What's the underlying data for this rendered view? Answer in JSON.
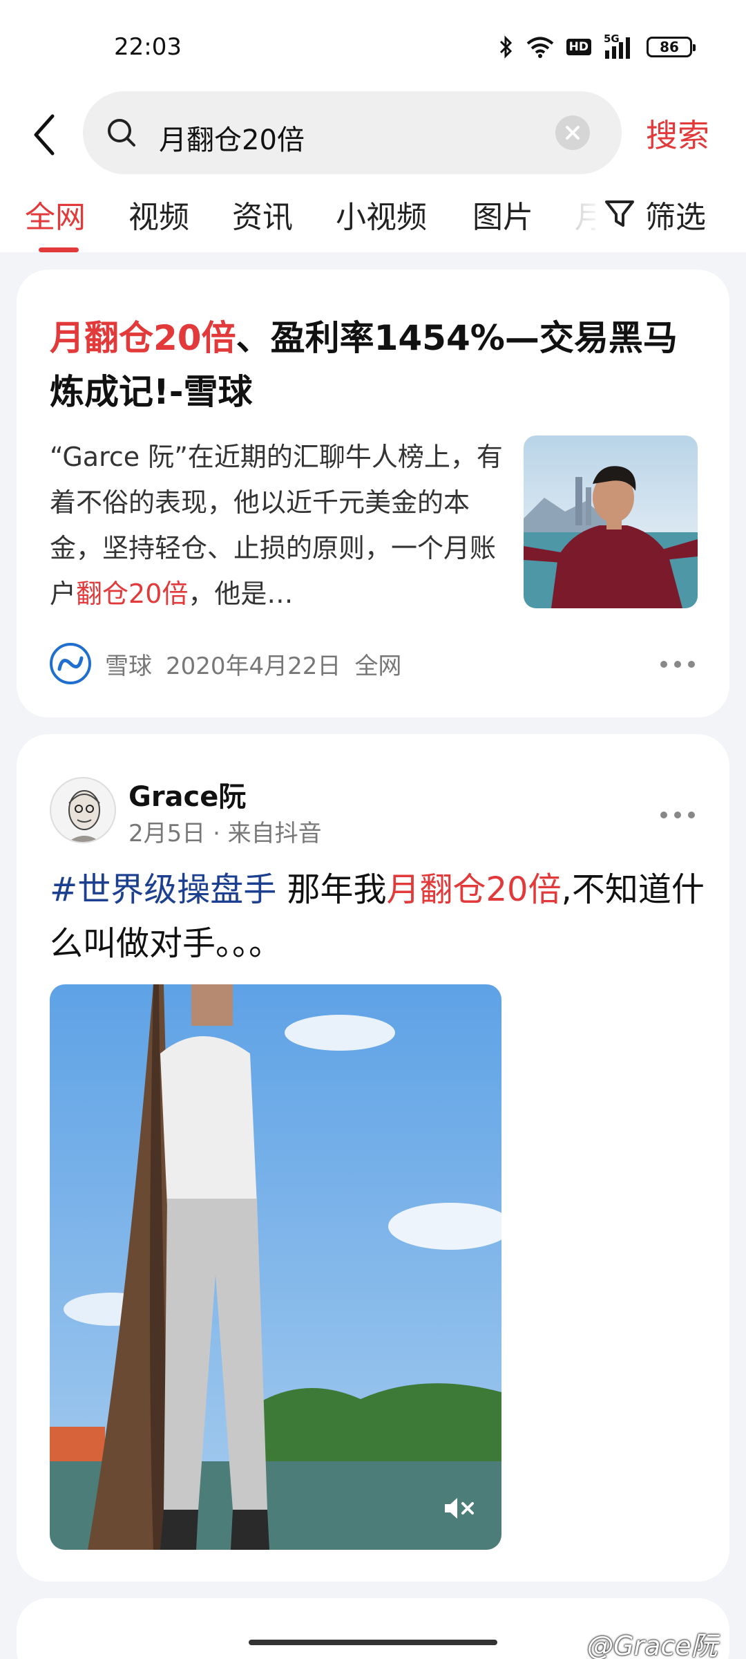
{
  "status_bar": {
    "time": "22:03",
    "network": "5G",
    "hd_badge": "HD",
    "battery": "86"
  },
  "search": {
    "query": "月翻仓20倍",
    "submit_label": "搜索"
  },
  "tabs": [
    {
      "label": "全网",
      "active": true
    },
    {
      "label": "视频",
      "active": false
    },
    {
      "label": "资讯",
      "active": false
    },
    {
      "label": "小视频",
      "active": false
    },
    {
      "label": "图片",
      "active": false
    },
    {
      "label": "月",
      "active": false
    }
  ],
  "filter": {
    "label": "筛选"
  },
  "result1": {
    "title_highlight": "月翻仓20倍",
    "title_rest": "、盈利率1454%—交易黑马炼成记!-雪球",
    "summary_before": "“Garce 阮”在近期的汇聊牛人榜上，有着不俗的表现，他以近千元美金的本金，坚持轻仓、止损的原则，一个月账户",
    "summary_highlight": "翻仓20倍",
    "summary_after": "，他是…",
    "source": "雪球",
    "date": "2020年4月22日",
    "scope": "全网"
  },
  "result2": {
    "author": "Grace阮",
    "meta": "2月5日 · 来自抖音",
    "hashtag": "#世界级操盘手",
    "text_before": " 那年我",
    "text_highlight": "月翻仓20倍",
    "text_after": ",不知道什么叫做对手。。。"
  },
  "watermark": "@Grace阮",
  "colors": {
    "accent": "#e23a3a",
    "hashtag": "#1d3f8f",
    "background": "#f3f4f7"
  }
}
